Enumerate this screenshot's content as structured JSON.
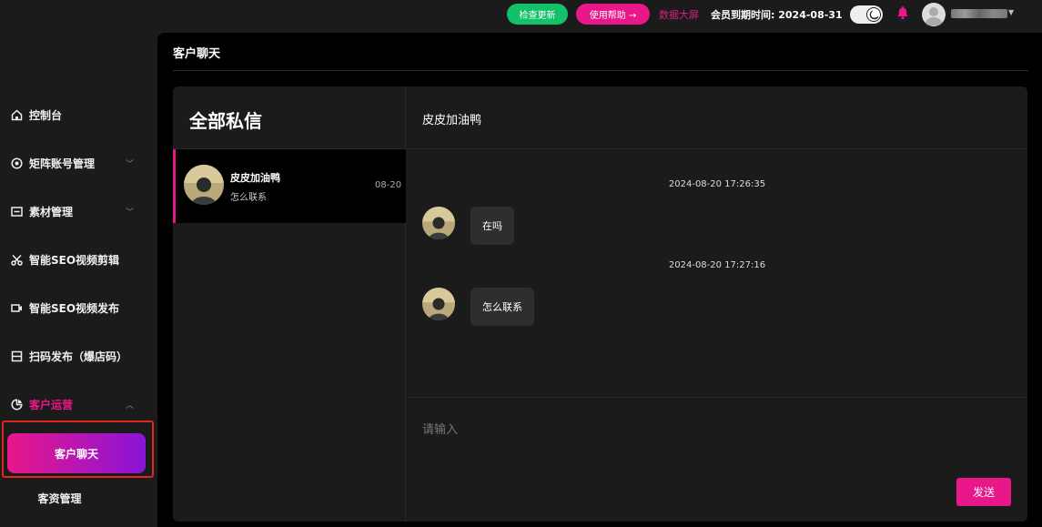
{
  "topbar": {
    "check_update": "检查更新",
    "help": "使用帮助 →",
    "big_screen": "数据大屏",
    "expire_label": "会员到期时间:",
    "expire_date": "2024-08-31",
    "accent": "#e8178a",
    "update_color": "#12c168"
  },
  "sidebar": {
    "items": [
      {
        "label": "控制台",
        "icon": "home-icon"
      },
      {
        "label": "矩阵账号管理",
        "icon": "target-icon"
      },
      {
        "label": "素材管理",
        "icon": "folder-icon"
      },
      {
        "label": "智能SEO视频剪辑",
        "icon": "scissors-icon"
      },
      {
        "label": "智能SEO视频发布",
        "icon": "video-icon"
      },
      {
        "label": "扫码发布（爆店码）",
        "icon": "qrcode-icon"
      },
      {
        "label": "客户运营",
        "icon": "pie-icon"
      }
    ],
    "sub_active": "客户聊天",
    "sub_item": "客资管理"
  },
  "main": {
    "page_title": "客户聊天",
    "left_heading": "全部私信",
    "conversation": {
      "name": "皮皮加油鸭",
      "preview": "怎么联系",
      "date": "08-20"
    },
    "chat_title": "皮皮加油鸭",
    "messages": [
      {
        "time": "2024-08-20 17:26:35",
        "text": "在吗"
      },
      {
        "time": "2024-08-20 17:27:16",
        "text": "怎么联系"
      }
    ],
    "input_placeholder": "请输入",
    "send_label": "发送"
  }
}
